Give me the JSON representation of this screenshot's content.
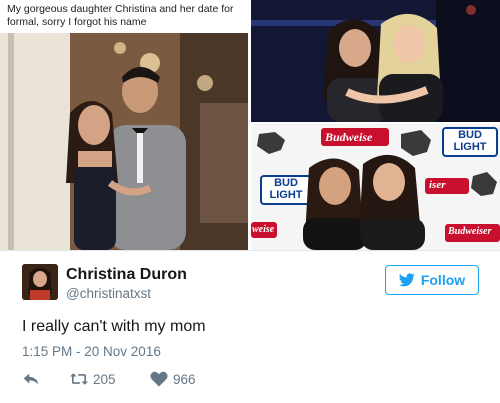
{
  "caption": "My gorgeous daughter Christina and her date for formal, sorry I forgot his name",
  "backdrop": {
    "brand_top": "Budweise",
    "brand_middle": "iser",
    "brand_bottom": "Budweiser",
    "brand_left": "weise",
    "bud_light_line1": "BUD",
    "bud_light_line2": "LIGHT"
  },
  "user": {
    "name": "Christina Duron",
    "handle": "@christinatxst"
  },
  "follow_label": "Follow",
  "tweet": {
    "text": "I really can't with my mom",
    "timestamp": "1:15 PM - 20 Nov 2016",
    "retweets": "205",
    "likes": "966"
  },
  "icons": {
    "follow": "twitter-bird-icon",
    "reply": "reply-icon",
    "retweet": "retweet-icon",
    "like": "heart-icon"
  },
  "colors": {
    "accent": "#1da1f2",
    "muted": "#657786",
    "text": "#14171a",
    "budweiser_red": "#c8102e",
    "bud_light_blue": "#0b3d91"
  }
}
